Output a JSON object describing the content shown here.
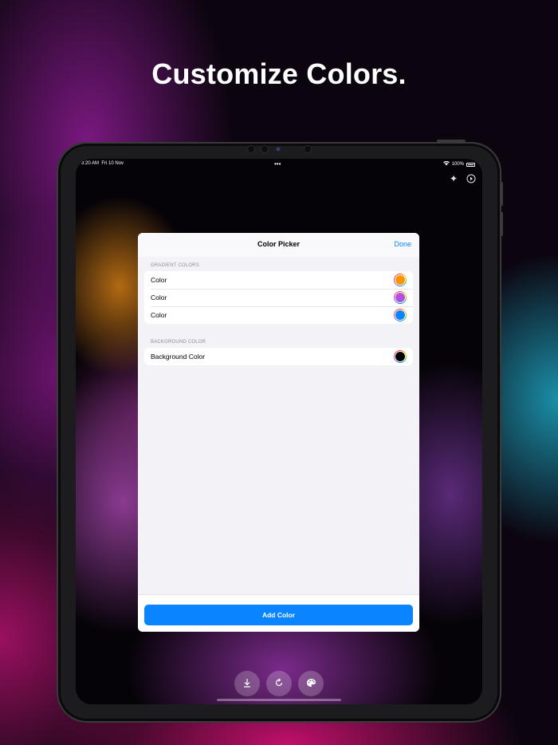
{
  "headline": "Customize Colors.",
  "status_bar": {
    "time": "3:20 AM",
    "date": "Fri 10 Nov",
    "battery": "100%"
  },
  "toolbar": {
    "icons": [
      "sparkle-icon",
      "play-icon"
    ]
  },
  "sheet": {
    "title": "Color Picker",
    "done_label": "Done",
    "gradient_header": "GRADIENT COLORS",
    "gradient_colors": [
      {
        "label": "Color",
        "color": "#ff9500"
      },
      {
        "label": "Color",
        "color": "#af52de"
      },
      {
        "label": "Color",
        "color": "#0a84ff"
      }
    ],
    "background_header": "BACKGROUND COLOR",
    "background_color": {
      "label": "Background Color",
      "color": "#000000"
    },
    "add_button_label": "Add Color"
  },
  "bottom_buttons": [
    "download-icon",
    "refresh-icon",
    "palette-icon"
  ],
  "accent_color": "#0a84ff"
}
